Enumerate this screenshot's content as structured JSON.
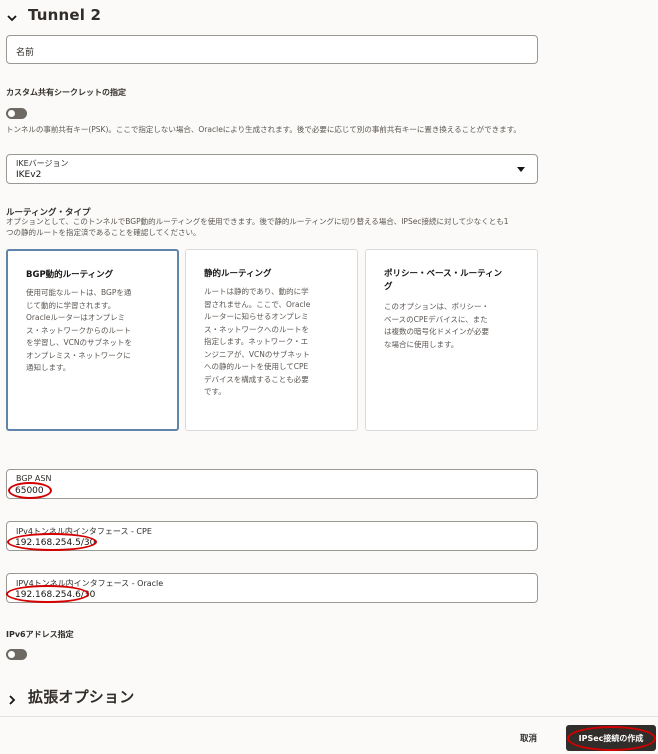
{
  "tunnel": {
    "title": "Tunnel 2",
    "name_placeholder": "名前",
    "custom_secret": {
      "label": "カスタム共有シークレットの指定",
      "help": "トンネルの事前共有キー(PSK)。ここで指定しない場合、Oracleにより生成されます。後で必要に応じて別の事前共有キーに置き換えることができます。"
    },
    "ike": {
      "label": "IKEバージョン",
      "value": "IKEv2"
    },
    "routing": {
      "title": "ルーティング・タイプ",
      "help_line1": "オプションとして、このトンネルでBGP動的ルーティングを使用できます。後で静的ルーティングに切り替える場合、IPSec接続に対して少なくとも1",
      "help_line2": "つの静的ルートを指定済であることを確認してください。",
      "cards": [
        {
          "title": "BGP動的ルーティング",
          "desc": [
            "使用可能なルートは、BGPを通",
            "じて動的に学習されます。",
            "Oracleルーターはオンプレミ",
            "ス・ネットワークからのルート",
            "を学習し、VCNのサブネットを",
            "オンプレミス・ネットワークに",
            "通知します。"
          ],
          "selected": true
        },
        {
          "title": "静的ルーティング",
          "desc": [
            "ルートは静的であり、動的に学",
            "習されません。ここで、Oracle",
            "ルーターに知らせるオンプレミ",
            "ス・ネットワークへのルートを",
            "指定します。ネットワーク・エ",
            "ンジニアが、VCNのサブネット",
            "への静的ルートを使用してCPE",
            "デバイスを構成することも必要",
            "です。"
          ],
          "selected": false
        },
        {
          "title_line1": "ポリシー・ベース・ルーティン",
          "title_line2": "グ",
          "desc": [
            "このオプションは、ポリシー・",
            "ベースのCPEデバイスに、また",
            "は複数の暗号化ドメインが必要",
            "な場合に使用します。"
          ],
          "selected": false
        }
      ]
    },
    "bgp_asn": {
      "label": "BGP ASN",
      "value": "65000"
    },
    "ipv4_cpe": {
      "label": "IPv4トンネル内インタフェース - CPE",
      "value": "192.168.254.5/30"
    },
    "ipv4_oracle": {
      "label": "IPV4トンネル内インタフェース - Oracle",
      "value": "192.168.254.6/30"
    },
    "ipv6": {
      "label": "IPv6アドレス指定"
    }
  },
  "advanced": {
    "title": "拡張オプション"
  },
  "footer": {
    "cancel": "取消",
    "create": "IPSec接続の作成"
  },
  "colors": {
    "highlight_oval": "#d40000",
    "primary_button": "#312d2a",
    "selected_card_border": "#5f86a8"
  }
}
